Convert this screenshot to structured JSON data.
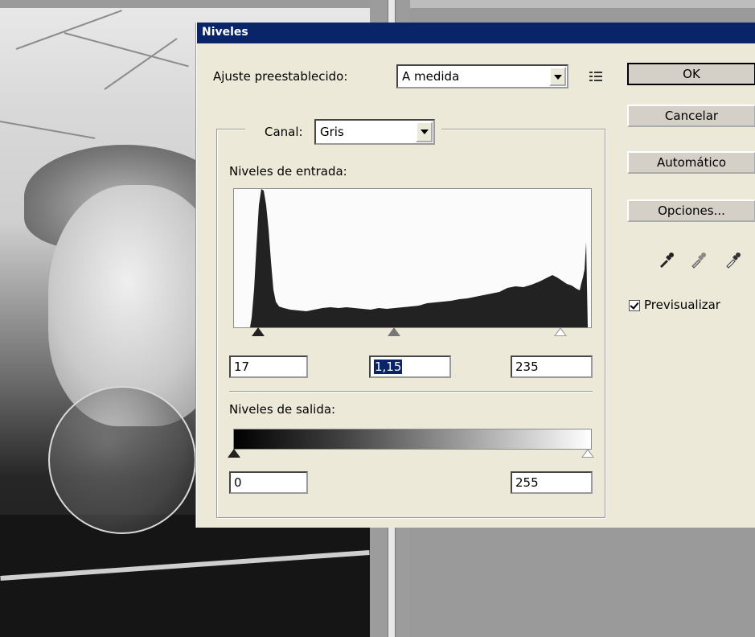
{
  "window": {
    "title": "Niveles"
  },
  "preset": {
    "label": "Ajuste preestablecido:",
    "value": "A medida"
  },
  "channel": {
    "label": "Canal:",
    "value": "Gris"
  },
  "input_levels": {
    "label": "Niveles de entrada:",
    "black": "17",
    "gamma": "1,15",
    "white": "235"
  },
  "output_levels": {
    "label": "Niveles de salida:",
    "black": "0",
    "white": "255"
  },
  "buttons": {
    "ok": "OK",
    "cancel": "Cancelar",
    "auto": "Automático",
    "options": "Opciones..."
  },
  "preview": {
    "label": "Previsualizar",
    "checked": true
  },
  "icons": [
    "preset-menu-icon",
    "black-eyedropper-icon",
    "gray-eyedropper-icon",
    "white-eyedropper-icon"
  ],
  "colors": {
    "titlebar": "#0a246a",
    "dialog_bg": "#ece9d8",
    "histogram": "#222222"
  }
}
